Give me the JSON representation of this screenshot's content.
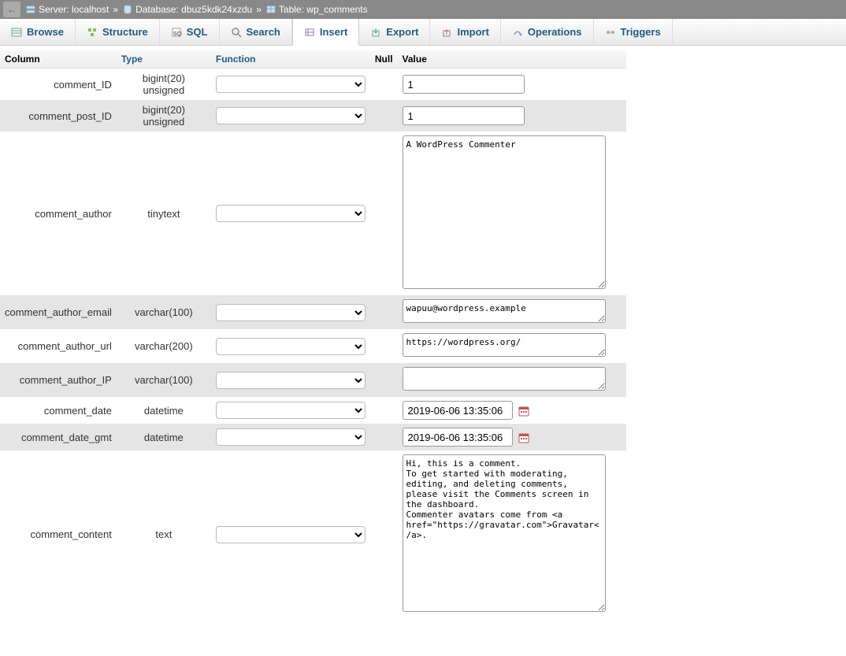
{
  "breadcrumb": {
    "server_label": "Server:",
    "server_value": "localhost",
    "db_label": "Database:",
    "db_value": "dbuz5kdk24xzdu",
    "table_label": "Table:",
    "table_value": "wp_comments",
    "sep": "»"
  },
  "tabs": {
    "browse": "Browse",
    "structure": "Structure",
    "sql": "SQL",
    "search": "Search",
    "insert": "Insert",
    "export": "Export",
    "import": "Import",
    "operations": "Operations",
    "triggers": "Triggers"
  },
  "headers": {
    "column": "Column",
    "type": "Type",
    "function": "Function",
    "null": "Null",
    "value": "Value"
  },
  "rows": [
    {
      "name": "comment_ID",
      "type": "bigint(20) unsigned",
      "input": "text",
      "value": "1"
    },
    {
      "name": "comment_post_ID",
      "type": "bigint(20) unsigned",
      "input": "text",
      "value": "1"
    },
    {
      "name": "comment_author",
      "type": "tinytext",
      "input": "textarea_big",
      "value": "A WordPress Commenter"
    },
    {
      "name": "comment_author_email",
      "type": "varchar(100)",
      "input": "textarea_small",
      "value": "wapuu@wordpress.example"
    },
    {
      "name": "comment_author_url",
      "type": "varchar(200)",
      "input": "textarea_small",
      "value": "https://wordpress.org/"
    },
    {
      "name": "comment_author_IP",
      "type": "varchar(100)",
      "input": "textarea_small",
      "value": ""
    },
    {
      "name": "comment_date",
      "type": "datetime",
      "input": "date",
      "value": "2019-06-06 13:35:06"
    },
    {
      "name": "comment_date_gmt",
      "type": "datetime",
      "input": "date",
      "value": "2019-06-06 13:35:06"
    },
    {
      "name": "comment_content",
      "type": "text",
      "input": "textarea_content",
      "value": "Hi, this is a comment.\nTo get started with moderating, editing, and deleting comments, please visit the Comments screen in the dashboard.\nCommenter avatars come from <a href=\"https://gravatar.com\">Gravatar</a>."
    }
  ]
}
